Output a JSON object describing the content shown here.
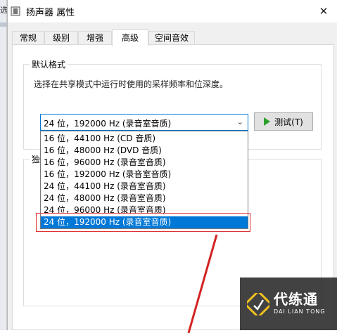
{
  "window": {
    "title": "扬声器 属性",
    "close_glyph": "✕"
  },
  "background_window": {
    "edge_glyph": "选"
  },
  "tabs": [
    {
      "label": "常规"
    },
    {
      "label": "级别"
    },
    {
      "label": "增强"
    },
    {
      "label": "高级",
      "active": true
    },
    {
      "label": "空间音效"
    }
  ],
  "default_format": {
    "group_label": "默认格式",
    "description": "选择在共享模式中运行时使用的采样频率和位深度。",
    "selected_value": "24 位，192000 Hz (录音室音质)",
    "test_button_label": "测试(T)",
    "options": [
      "16 位，44100 Hz (CD 音质)",
      "16 位，48000 Hz (DVD 音质)",
      "16 位，96000 Hz (录音室音质)",
      "16 位，192000 Hz (录音室音质)",
      "24 位，44100 Hz (录音室音质)",
      "24 位，48000 Hz (录音室音质)",
      "24 位，96000 Hz (录音室音质)",
      "24 位，192000 Hz (录音室音质)"
    ],
    "selected_index": 7
  },
  "exclusive_mode": {
    "group_label_partial": "独"
  },
  "watermark": {
    "name": "代练通",
    "sub": "DAI LIAN TONG"
  },
  "colors": {
    "accent": "#0078d7",
    "highlight_box": "#e03232",
    "play_icon": "#2ca02c"
  }
}
